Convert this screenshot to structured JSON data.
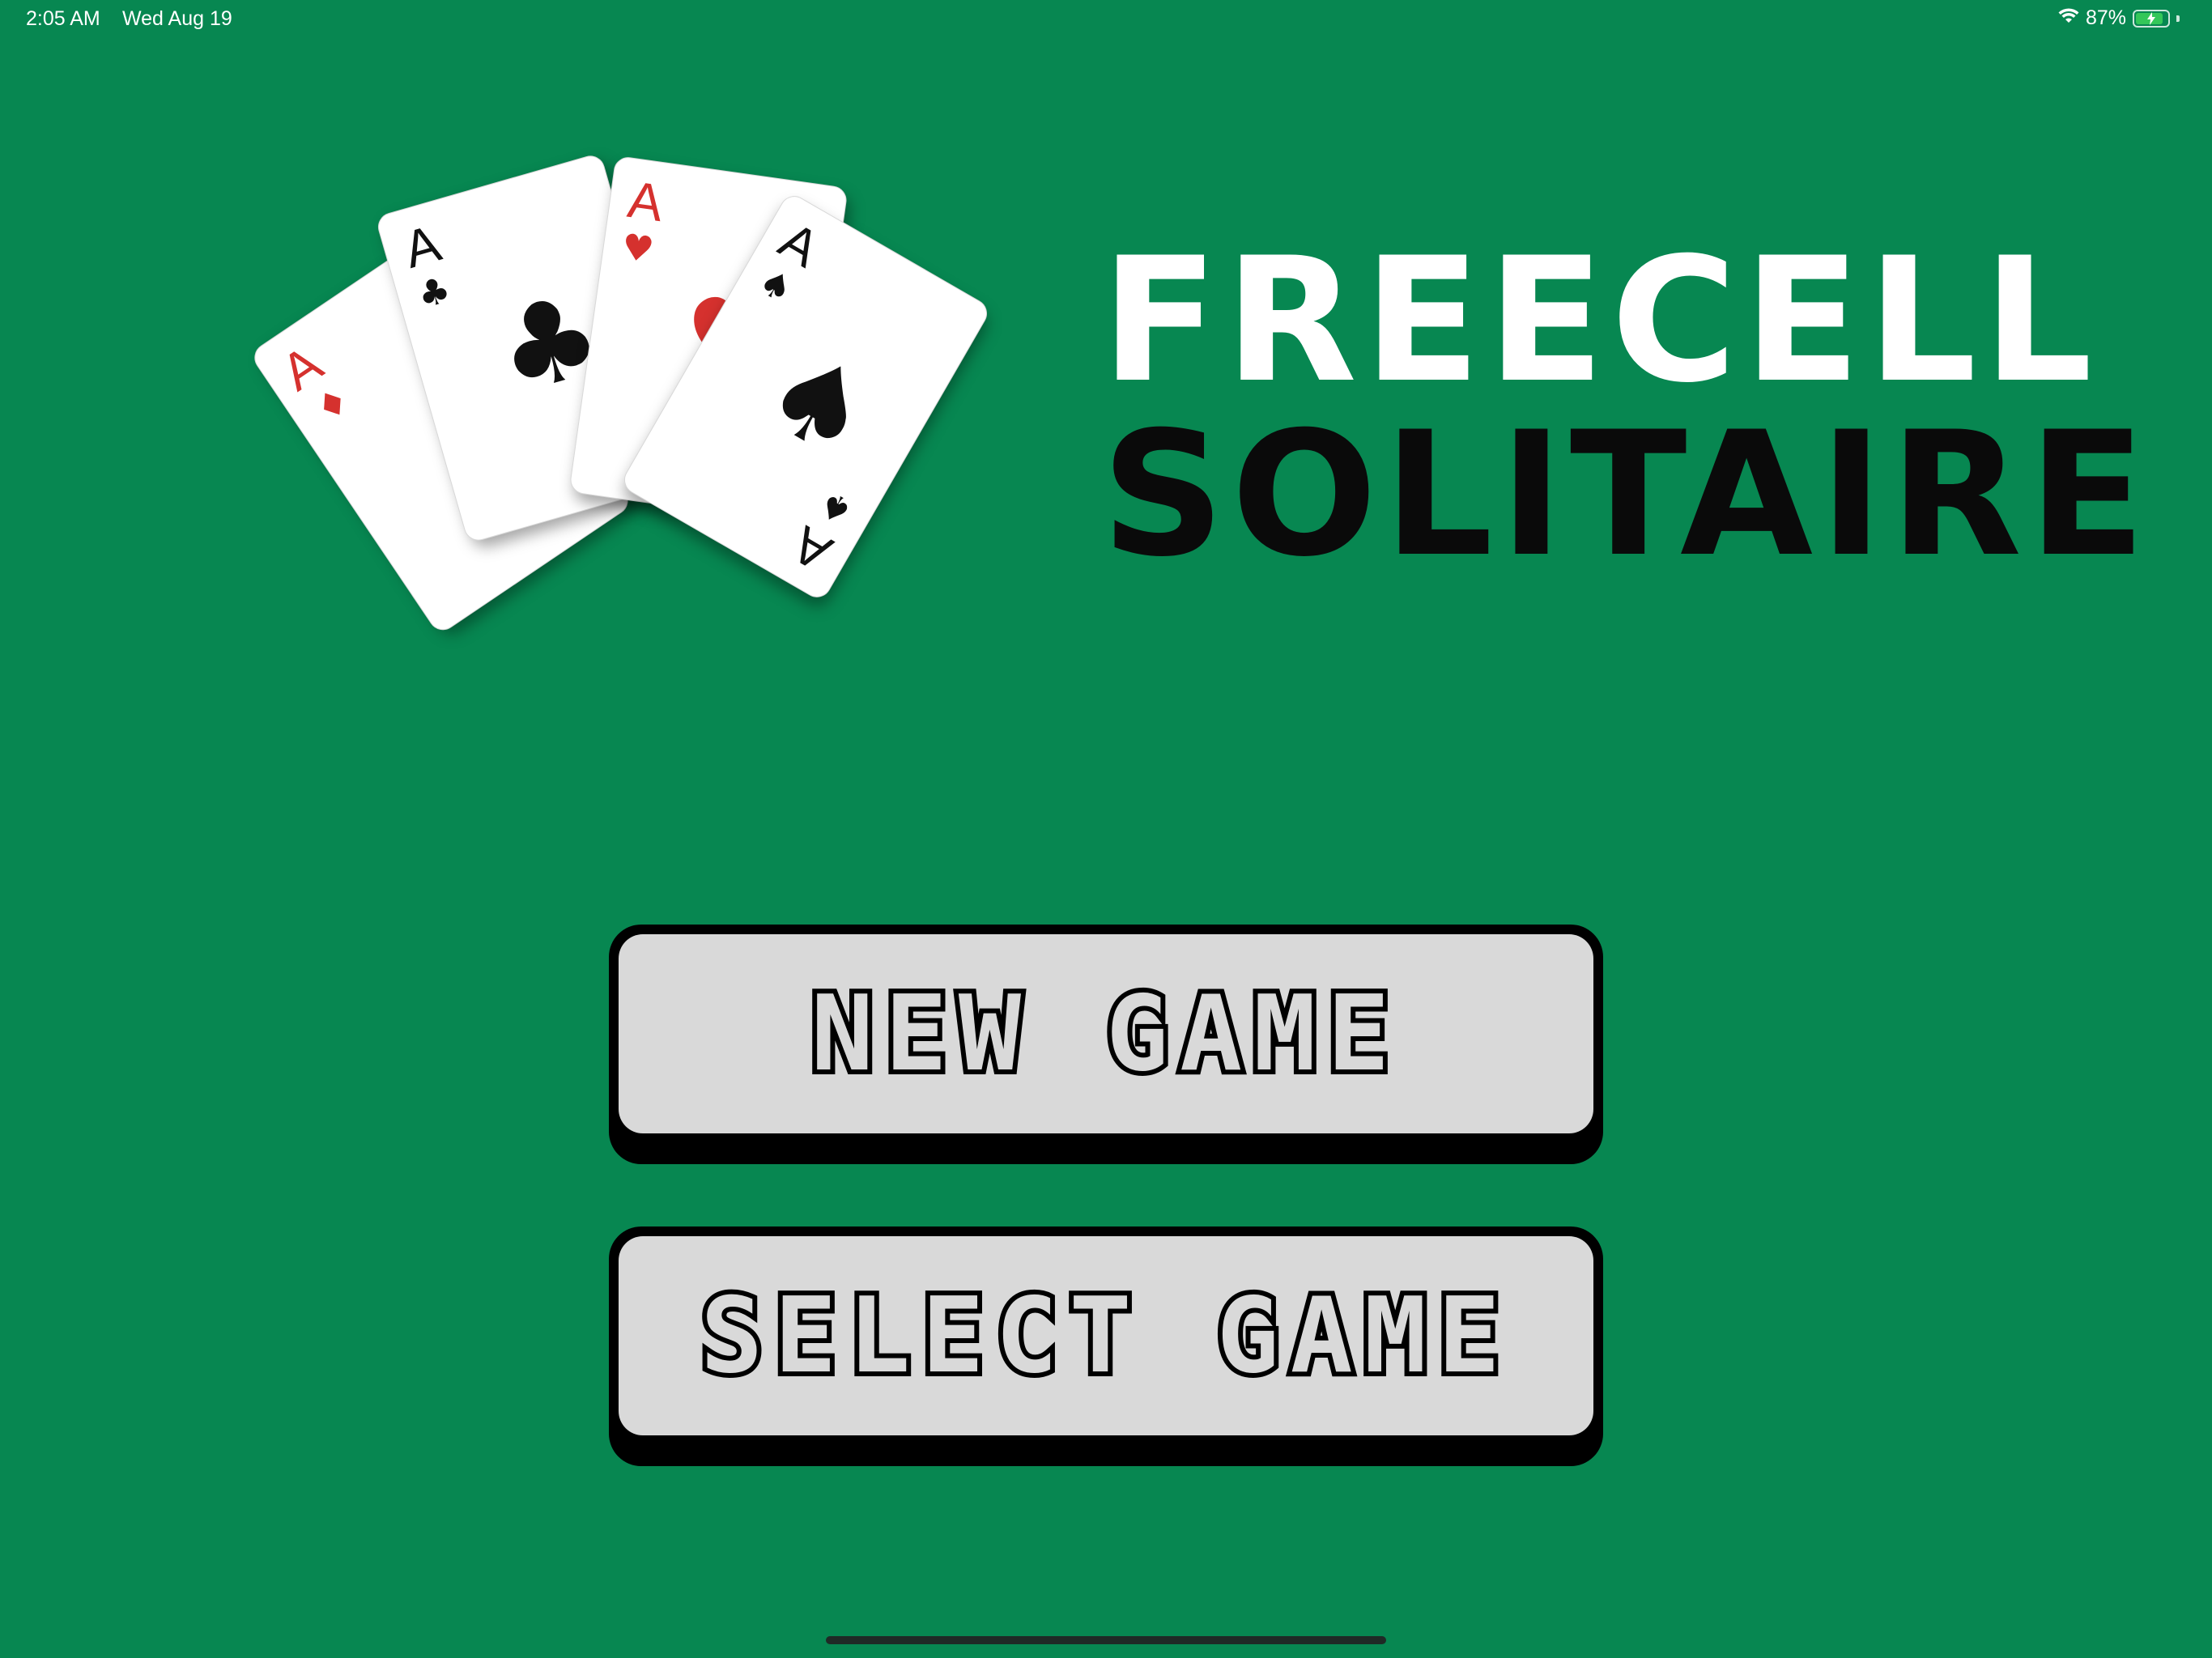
{
  "status_bar": {
    "time": "2:05 AM",
    "date": "Wed Aug 19",
    "battery_percent_text": "87%",
    "battery_level": 0.87,
    "wifi_icon": "wifi-icon",
    "battery_icon": "battery-charging-icon"
  },
  "logo": {
    "cards": [
      {
        "rank": "A",
        "suit": "diamonds",
        "symbol": "♦",
        "color": "#d5312e"
      },
      {
        "rank": "A",
        "suit": "clubs",
        "symbol": "♣",
        "color": "#111111"
      },
      {
        "rank": "A",
        "suit": "hearts",
        "symbol": "♥",
        "color": "#d5312e"
      },
      {
        "rank": "A",
        "suit": "spades",
        "symbol": "♠",
        "color": "#111111"
      }
    ]
  },
  "title": {
    "line1": "FREECELL",
    "line2": "SOLITAIRE"
  },
  "menu": {
    "new_game_label": "NEW GAME",
    "select_game_label": "SELECT GAME"
  },
  "colors": {
    "background": "#078751",
    "button_face": "#d9d9d9",
    "button_border": "#000000"
  }
}
